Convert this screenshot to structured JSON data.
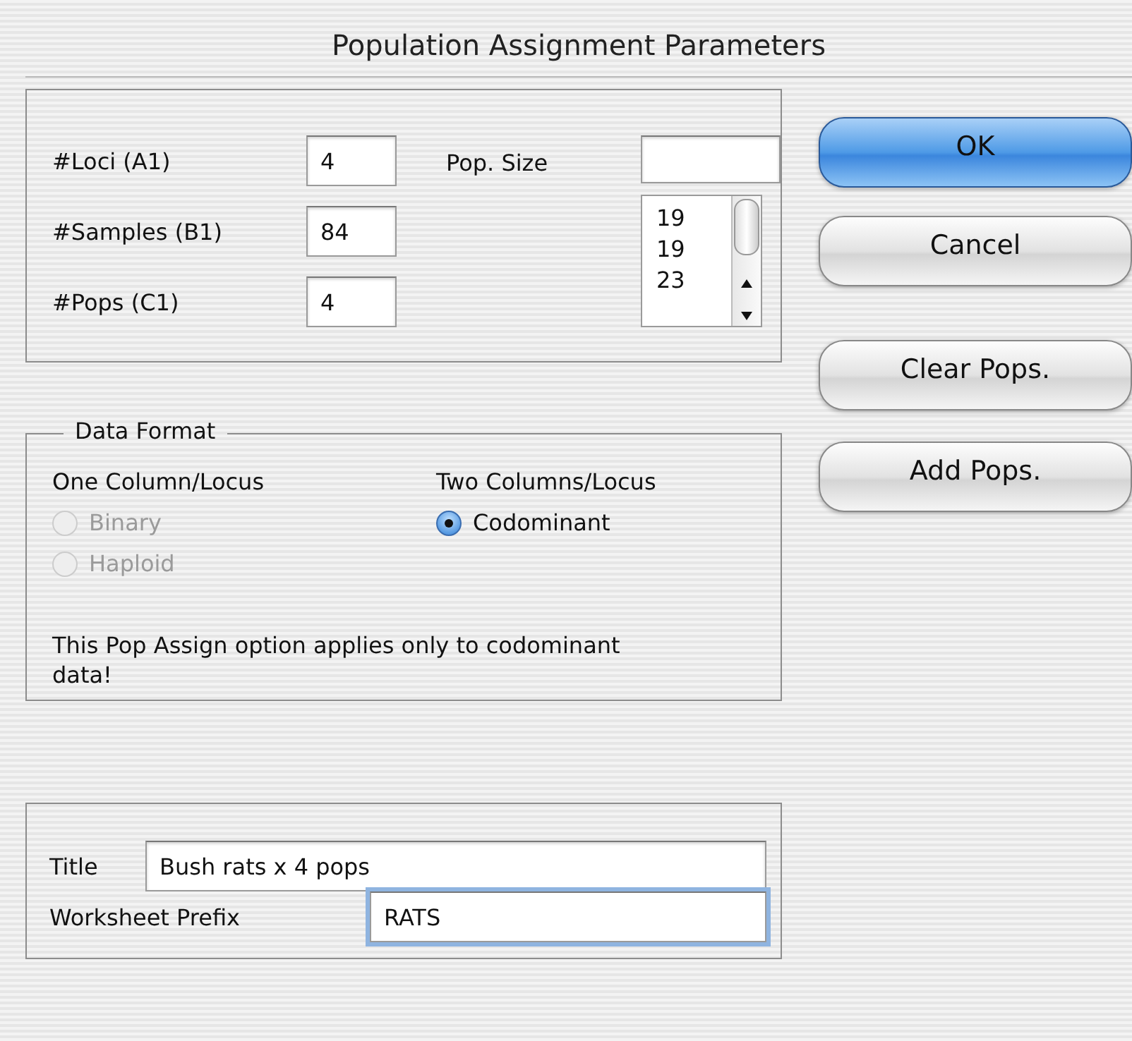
{
  "window": {
    "title": "Population Assignment Parameters"
  },
  "counts": [
    {
      "label": "#Loci (A1)",
      "value": "4"
    },
    {
      "label": "#Samples (B1)",
      "value": "84"
    },
    {
      "label": "#Pops (C1)",
      "value": "4"
    }
  ],
  "pop_size": {
    "label": "Pop. Size",
    "values": [
      "19",
      "19",
      "23"
    ]
  },
  "data_format": {
    "legend": "Data Format",
    "columns": [
      {
        "heading": "One Column/Locus",
        "options": [
          {
            "label": "Binary",
            "selected": false,
            "disabled": true
          },
          {
            "label": "Haploid",
            "selected": false,
            "disabled": true
          }
        ]
      },
      {
        "heading": "Two Columns/Locus",
        "options": [
          {
            "label": "Codominant",
            "selected": true,
            "disabled": false
          }
        ]
      }
    ],
    "note": "This Pop Assign option applies only to codominant data!"
  },
  "title_field": {
    "label": "Title",
    "value": "Bush rats x 4 pops"
  },
  "prefix_field": {
    "label": "Worksheet Prefix",
    "value": "RATS",
    "focused": true
  },
  "buttons": [
    {
      "label": "OK",
      "default": true
    },
    {
      "label": "Cancel",
      "default": false
    },
    {
      "label": "Clear Pops.",
      "default": false
    },
    {
      "label": "Add Pops.",
      "default": false
    }
  ]
}
